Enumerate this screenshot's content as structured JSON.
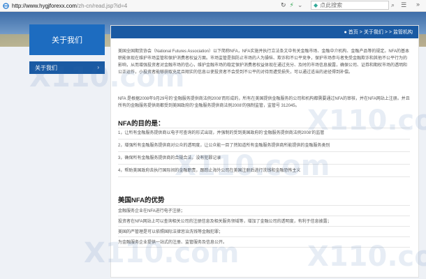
{
  "browser": {
    "url_host": "http://www.hygjforexx.com",
    "url_path": "/zh-cn/read.jsp?id=4",
    "search_placeholder": "点此搜索"
  },
  "sidebar": {
    "title": "关于我们",
    "items": [
      {
        "label": "关于我们",
        "arrow": "›"
      }
    ]
  },
  "breadcrumb": {
    "home": "首页",
    "sep1": ">",
    "about": "关于我们",
    "sep2": "> >",
    "current": "监管机构"
  },
  "content": {
    "intro": "美国全国期货协会（National Futures Association）以下简称NFA，NFA实施并执行立法条文中有关金融市场、金融中介机构、金融产品等的规定。NFA的基本职能体现在维护市场监管和保护消费者权益方面。市场监管是指防止市场的人为操纵、欺诈和不公平竞争，保护市场参与者免受金融欺诈和其他不公平行为的影响，从而增强投资者对金融市场的信心，维护金融市场的稳定保护消费者权益体现在通过充分、及时的市场信息披露，确保公司、证券和期权市场的透明和公正运作，小投资者能够获取充足且翔实的信息以使投资者不会受到不公平的对待而遭受损失，可以通过适当的途径得到补偿。",
    "para2": "NFA 是根据2008年9月29号的‘金融服务提供商法例2008’而形成的，所有在美国提供金融服务的公司和机构都需要通过NFA的审核，并在NFA网站上注册。并且所有的金融服务提供商都受到美国政府的‘金融服务提供商法例2008’的强制监管，监管号 312045。",
    "goals_title": "NFA的目的是：",
    "goals": [
      "1，让所有金融服务提供商以电子可查询的形式出现，并强制的受到美国政府的‘金融服务提供商法例2008’的监管",
      "2，增强所有金融服务提供商对公众的透明度，让公众能一目了然知道所有金融服务提供商所能提供的金融服务类别",
      "3，确保所有金融服务提供商的合规合法，没有犯罪记录",
      "4，帮助美国政府去执行国际间的金融职责，跟踪止海外公司在美国注册后进行洗钱和金融恐怖主义"
    ],
    "adv_title": "美国NFA的优势",
    "advantages": [
      "金融服务企业在NFA进行电子注册；",
      "投资者在NFA网站上可以查询相关公司的注册信息及相关服务领域等，增加了金融公司的透明度，有利于信息披露；",
      "美国的严管理是可以依照国际法律惩治洗钱等金融犯罪；",
      "为金融服务企业提供一站式的注册、监管服务及信息公开。"
    ]
  },
  "watermark": "X110.com"
}
